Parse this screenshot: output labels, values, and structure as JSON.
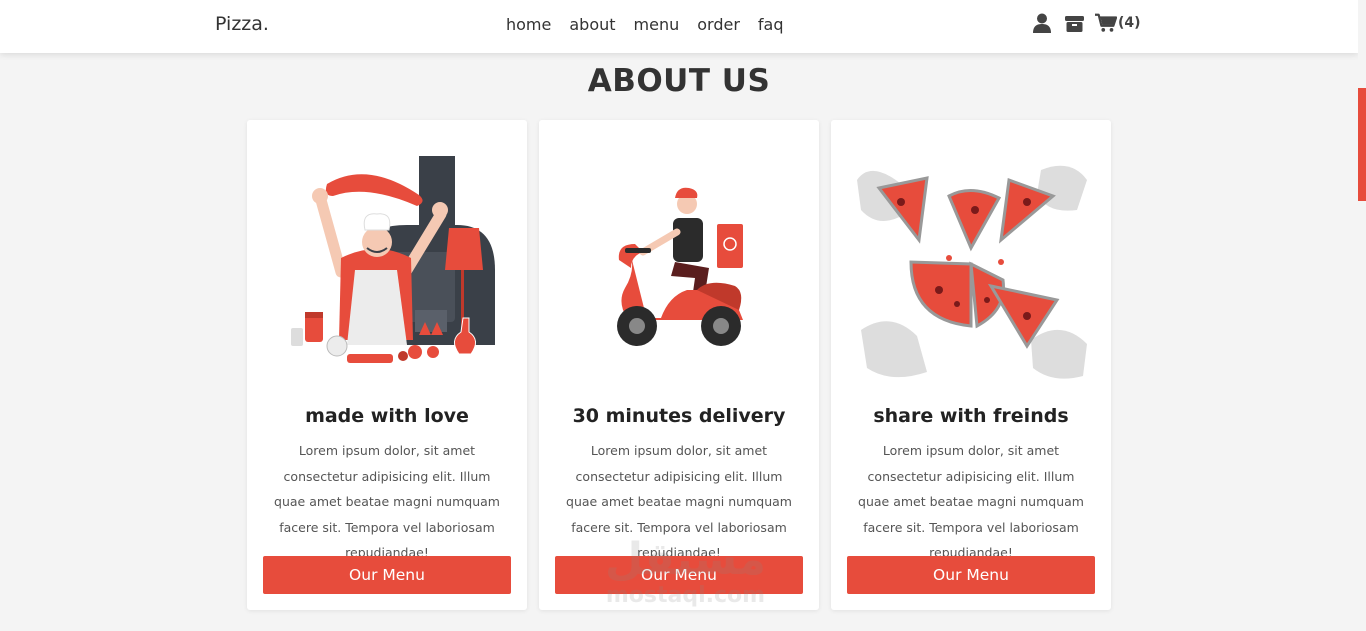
{
  "header": {
    "logo": "Pizza.",
    "nav": [
      "home",
      "about",
      "menu",
      "order",
      "faq"
    ],
    "icons": [
      "user-icon",
      "box-icon",
      "cart-icon"
    ],
    "cart_count": "(4)"
  },
  "section": {
    "title": "ABOUT US"
  },
  "cards": [
    {
      "title": "made with love",
      "text": "Lorem ipsum dolor, sit amet consectetur adipisicing elit. Illum quae amet beatae magni numquam facere sit. Tempora vel laboriosam repudiandae!",
      "button": "Our Menu",
      "image": "chef-tossing-pizza-illustration"
    },
    {
      "title": "30 minutes delivery",
      "text": "Lorem ipsum dolor, sit amet consectetur adipisicing elit. Illum quae amet beatae magni numquam facere sit. Tempora vel laboriosam repudiandae!",
      "button": "Our Menu",
      "image": "scooter-delivery-illustration"
    },
    {
      "title": "share with freinds",
      "text": "Lorem ipsum dolor, sit amet consectetur adipisicing elit. Illum quae amet beatae magni numquam facere sit. Tempora vel laboriosam repudiandae!",
      "button": "Our Menu",
      "image": "friends-sharing-pizza-illustration"
    }
  ],
  "watermark": {
    "arabic": "مستقل",
    "latin": "mostaql.com"
  },
  "colors": {
    "accent": "#e74c3c",
    "background": "#f4f4f4",
    "text": "#333333"
  }
}
